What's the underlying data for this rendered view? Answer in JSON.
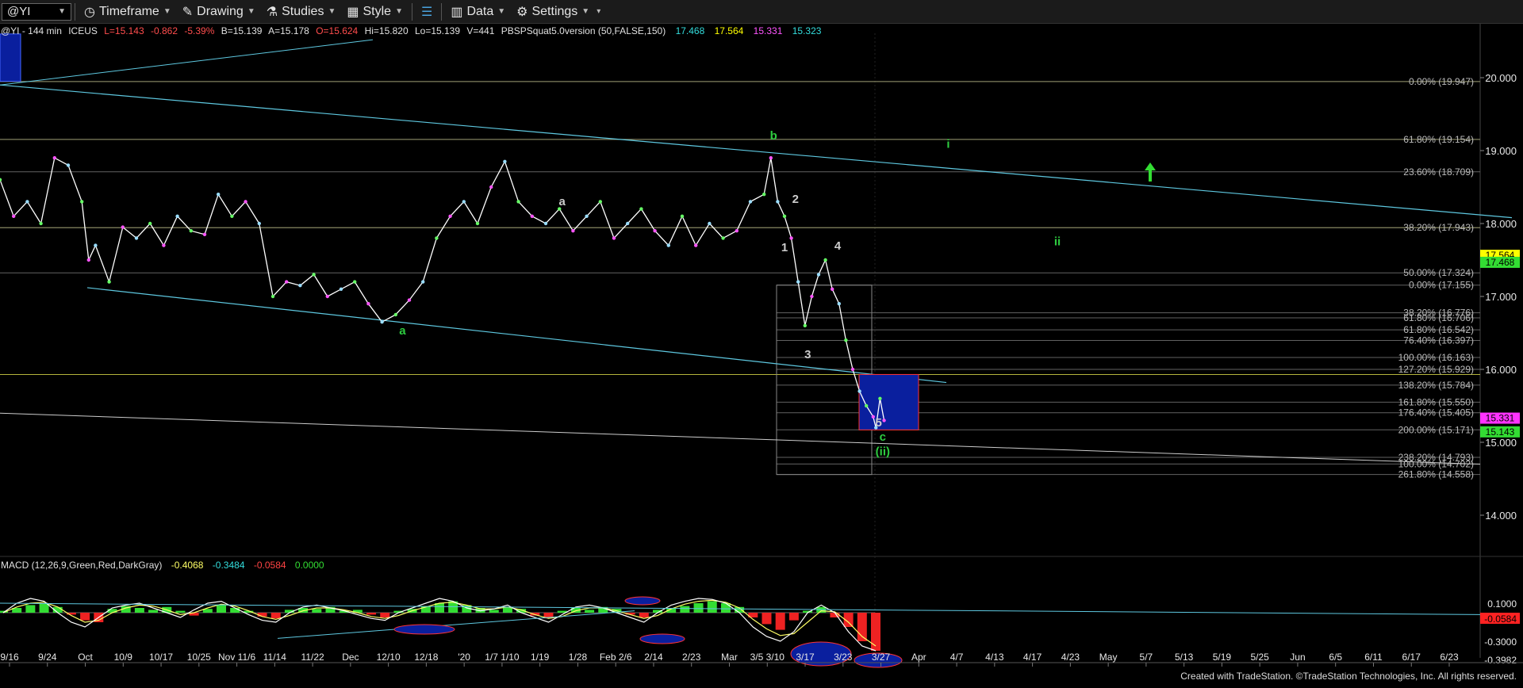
{
  "toolbar": {
    "symbol": "@YI",
    "timeframe": "Timeframe",
    "drawing": "Drawing",
    "studies": "Studies",
    "style": "Style",
    "data": "Data",
    "settings": "Settings"
  },
  "header": {
    "symbol_line": "@YI - 144 min",
    "exchange": "ICEUS",
    "last": "L=15.143",
    "change": "-0.862",
    "change_pct": "-5.39%",
    "bid": "B=15.139",
    "ask": "A=15.178",
    "open": "O=15.624",
    "high": "Hi=15.820",
    "low": "Lo=15.139",
    "volume": "V=441",
    "indicator": "PBSPSquat5.0version (50,FALSE,150)",
    "ind_values": [
      "17.468",
      "17.564",
      "15.331",
      "15.323"
    ]
  },
  "macd_header": {
    "label": "MACD (12,26,9,Green,Red,DarkGray)",
    "values": [
      "-0.4068",
      "-0.3484",
      "-0.0584",
      "0.0000"
    ]
  },
  "footer": "Created with TradeStation. ©TradeStation Technologies, Inc. All rights reserved.",
  "colors": {
    "price": "#ffffff",
    "fib": "#7a7a7a",
    "yellow_line": "#b4b43c",
    "trend": "#5ec8e0",
    "wave_green": "#2ecc40",
    "target_box": "#0a1f9e",
    "macd_pos": "#33dd33",
    "macd_neg": "#ee2222"
  },
  "chart_data": {
    "type": "line",
    "price_axis": {
      "ticks": [
        20.0,
        19.0,
        18.0,
        17.0,
        16.0,
        15.0,
        14.0
      ],
      "labels": [
        "20.000",
        "19.000",
        "18.000",
        "17.000",
        "16.000",
        "15.000",
        "14.000"
      ]
    },
    "price_tags": [
      {
        "value": 17.564,
        "label": "17.564",
        "color": "#ffff00"
      },
      {
        "value": 17.468,
        "label": "17.468",
        "color": "#33dd33"
      },
      {
        "value": 15.331,
        "label": "15.331",
        "color": "#ff33ff"
      },
      {
        "value": 15.143,
        "label": "15.143",
        "color": "#33dd33"
      }
    ],
    "x_labels": [
      "9/16",
      "9/24",
      "Oct",
      "10/9",
      "10/17",
      "10/25",
      "Nov 11/6",
      "11/14",
      "11/22",
      "Dec",
      "12/10",
      "12/18",
      "'20",
      "1/7 1/10",
      "1/19",
      "1/28",
      "Feb 2/6",
      "2/14",
      "2/23",
      "Mar",
      "3/5 3/10",
      "3/17",
      "3/23",
      "3/27",
      "Apr",
      "4/7",
      "4/13",
      "4/17",
      "4/23",
      "May",
      "5/7",
      "5/13",
      "5/19",
      "5/25",
      "Jun",
      "6/5",
      "6/11",
      "6/17",
      "6/23"
    ],
    "fib_levels": [
      {
        "value": 19.947,
        "label": "0.00% (19.947)"
      },
      {
        "value": 19.154,
        "label": "61.80% (19.154)"
      },
      {
        "value": 18.709,
        "label": "23.60% (18.709)"
      },
      {
        "value": 17.943,
        "label": "38.20% (17.943)"
      },
      {
        "value": 17.324,
        "label": "50.00% (17.324)"
      },
      {
        "value": 17.155,
        "label": "0.00% (17.155)"
      },
      {
        "value": 16.776,
        "label": "38.20% (16.776)"
      },
      {
        "value": 16.706,
        "label": "61.80% (16.706)"
      },
      {
        "value": 16.542,
        "label": "61.80% (16.542)"
      },
      {
        "value": 16.397,
        "label": "76.40% (16.397)"
      },
      {
        "value": 16.163,
        "label": "100.00% (16.163)"
      },
      {
        "value": 16.0,
        "label": "127.20% (15.929)"
      },
      {
        "value": 15.784,
        "label": "138.20% (15.784)"
      },
      {
        "value": 15.55,
        "label": "161.80% (15.550)"
      },
      {
        "value": 15.405,
        "label": "176.40% (15.405)"
      },
      {
        "value": 15.171,
        "label": "200.00% (15.171)"
      },
      {
        "value": 14.793,
        "label": "238.20% (14.793)"
      },
      {
        "value": 14.702,
        "label": "100.00% (14.702)"
      },
      {
        "value": 14.558,
        "label": "261.80% (14.558)"
      }
    ],
    "wave_labels": [
      {
        "text": "b",
        "t": 0.567,
        "value": 19.15,
        "color": "#2ecc40"
      },
      {
        "text": "a",
        "t": 0.295,
        "value": 16.48,
        "color": "#2ecc40"
      },
      {
        "text": "i",
        "t": 0.695,
        "value": 19.04,
        "color": "#2ecc40"
      },
      {
        "text": "ii",
        "t": 0.775,
        "value": 17.7,
        "color": "#2ecc40"
      },
      {
        "text": "c",
        "t": 0.647,
        "value": 15.02,
        "color": "#2ecc40"
      },
      {
        "text": "(ii)",
        "t": 0.647,
        "value": 14.82,
        "color": "#2ecc40"
      },
      {
        "text": "2",
        "t": 0.583,
        "value": 18.28,
        "color": "#cccccc"
      },
      {
        "text": "1",
        "t": 0.575,
        "value": 17.62,
        "color": "#cccccc"
      },
      {
        "text": "4",
        "t": 0.614,
        "value": 17.64,
        "color": "#cccccc"
      },
      {
        "text": "3",
        "t": 0.592,
        "value": 16.15,
        "color": "#cccccc"
      },
      {
        "text": "5",
        "t": 0.644,
        "value": 15.22,
        "color": "#cccccc"
      },
      {
        "text": "a",
        "t": 0.412,
        "value": 18.25,
        "color": "#cccccc"
      }
    ],
    "series": [
      {
        "name": "price",
        "t": [
          0,
          0.01,
          0.02,
          0.03,
          0.04,
          0.05,
          0.06,
          0.065,
          0.07,
          0.08,
          0.09,
          0.1,
          0.11,
          0.12,
          0.13,
          0.14,
          0.15,
          0.16,
          0.17,
          0.18,
          0.19,
          0.2,
          0.21,
          0.22,
          0.23,
          0.24,
          0.25,
          0.26,
          0.27,
          0.28,
          0.29,
          0.3,
          0.31,
          0.32,
          0.33,
          0.34,
          0.35,
          0.36,
          0.37,
          0.38,
          0.39,
          0.4,
          0.41,
          0.42,
          0.43,
          0.44,
          0.45,
          0.46,
          0.47,
          0.48,
          0.49,
          0.5,
          0.51,
          0.52,
          0.53,
          0.54,
          0.55,
          0.56,
          0.565,
          0.57,
          0.575,
          0.58,
          0.585,
          0.59,
          0.595,
          0.6,
          0.605,
          0.61,
          0.615,
          0.62,
          0.625,
          0.63,
          0.635,
          0.64,
          0.642,
          0.645,
          0.648
        ],
        "values": [
          18.6,
          18.1,
          18.3,
          18.0,
          18.9,
          18.8,
          18.3,
          17.5,
          17.7,
          17.2,
          17.95,
          17.8,
          18.0,
          17.7,
          18.1,
          17.9,
          17.85,
          18.4,
          18.1,
          18.3,
          18.0,
          17.0,
          17.2,
          17.15,
          17.3,
          17.0,
          17.1,
          17.2,
          16.9,
          16.65,
          16.75,
          16.95,
          17.2,
          17.8,
          18.1,
          18.3,
          18.0,
          18.5,
          18.85,
          18.3,
          18.1,
          18.0,
          18.2,
          17.9,
          18.1,
          18.3,
          17.8,
          18.0,
          18.2,
          17.9,
          17.7,
          18.1,
          17.7,
          18.0,
          17.8,
          17.9,
          18.3,
          18.4,
          18.9,
          18.3,
          18.1,
          17.8,
          17.2,
          16.6,
          17.0,
          17.3,
          17.5,
          17.1,
          16.9,
          16.4,
          16.0,
          15.7,
          15.5,
          15.35,
          15.2,
          15.6,
          15.3
        ]
      }
    ],
    "macd": {
      "zero_line": 0,
      "axis_labels": [
        "0.1000",
        "-0.0584",
        "-0.3000",
        "-0.3982"
      ],
      "hist": [
        0.02,
        0.05,
        0.08,
        0.1,
        0.06,
        -0.02,
        -0.08,
        -0.1,
        0.04,
        0.07,
        0.05,
        0.03,
        0.06,
        0.02,
        -0.03,
        0.04,
        0.08,
        0.05,
        0.02,
        -0.04,
        -0.06,
        0.03,
        0.05,
        0.04,
        0.06,
        0.02,
        0.03,
        -0.02,
        -0.05,
        0.02,
        0.04,
        0.07,
        0.1,
        0.12,
        0.08,
        0.05,
        0.03,
        0.06,
        0.04,
        -0.03,
        -0.06,
        0.02,
        0.05,
        0.03,
        0.06,
        0.04,
        -0.02,
        -0.05,
        0.03,
        0.05,
        0.07,
        0.1,
        0.12,
        0.1,
        0.06,
        -0.05,
        -0.12,
        -0.18,
        -0.08,
        0.02,
        0.06,
        -0.05,
        -0.15,
        -0.3,
        -0.4
      ],
      "line": [
        0.0,
        0.1,
        0.15,
        0.12,
        0.0,
        -0.1,
        -0.15,
        -0.05,
        0.05,
        0.08,
        0.1,
        0.05,
        0.0,
        -0.05,
        0.03,
        0.1,
        0.12,
        0.05,
        -0.02,
        -0.08,
        -0.1,
        0.0,
        0.06,
        0.08,
        0.05,
        0.02,
        -0.02,
        -0.06,
        -0.08,
        0.0,
        0.05,
        0.1,
        0.15,
        0.12,
        0.05,
        0.02,
        0.04,
        0.08,
        0.0,
        -0.05,
        -0.1,
        -0.02,
        0.06,
        0.08,
        0.05,
        0.0,
        -0.05,
        -0.1,
        0.0,
        0.08,
        0.12,
        0.15,
        0.14,
        0.1,
        0.0,
        -0.15,
        -0.25,
        -0.3,
        -0.2,
        0.0,
        0.08,
        0.0,
        -0.2,
        -0.35,
        -0.4
      ],
      "signal": [
        0.0,
        0.06,
        0.1,
        0.11,
        0.06,
        -0.03,
        -0.1,
        -0.08,
        0.0,
        0.05,
        0.08,
        0.07,
        0.03,
        -0.02,
        0.0,
        0.05,
        0.09,
        0.07,
        0.02,
        -0.04,
        -0.07,
        -0.03,
        0.02,
        0.05,
        0.05,
        0.03,
        0.0,
        -0.04,
        -0.06,
        -0.03,
        0.02,
        0.06,
        0.1,
        0.11,
        0.08,
        0.04,
        0.04,
        0.06,
        0.03,
        -0.02,
        -0.06,
        -0.04,
        0.02,
        0.05,
        0.05,
        0.02,
        -0.02,
        -0.06,
        -0.03,
        0.04,
        0.09,
        0.12,
        0.13,
        0.11,
        0.05,
        -0.07,
        -0.17,
        -0.24,
        -0.22,
        -0.1,
        0.02,
        0.01,
        -0.1,
        -0.25,
        -0.35
      ]
    }
  }
}
